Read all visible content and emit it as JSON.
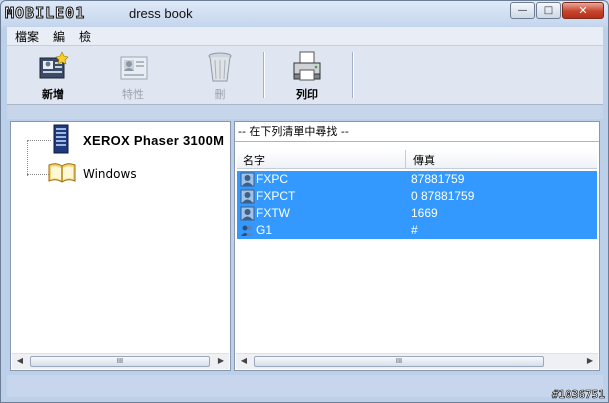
{
  "window": {
    "logo_text": "MOBILE01",
    "title": "dress book",
    "minimize": "—",
    "maximize": "□",
    "close": "✕"
  },
  "menu": [
    "檔案",
    "編",
    "檢"
  ],
  "toolbar": {
    "new_label": "新增",
    "properties_label": "特性",
    "delete_label": "刪",
    "print_label": "列印"
  },
  "tree": {
    "printer": "XEROX  Phaser 3100M",
    "folder": "Windows"
  },
  "list": {
    "search_text": "-- 在下列清單中尋找 --",
    "col_name": "名字",
    "col_fax": "傳真",
    "rows": [
      {
        "name": "FXPC",
        "fax": "87881759"
      },
      {
        "name": "FXPCT",
        "fax": "0 87881759"
      },
      {
        "name": "FXTW",
        "fax": "1669"
      },
      {
        "name": "G1",
        "fax": "#"
      }
    ]
  },
  "scroll_glyph": "III",
  "watermark": "#1036751"
}
